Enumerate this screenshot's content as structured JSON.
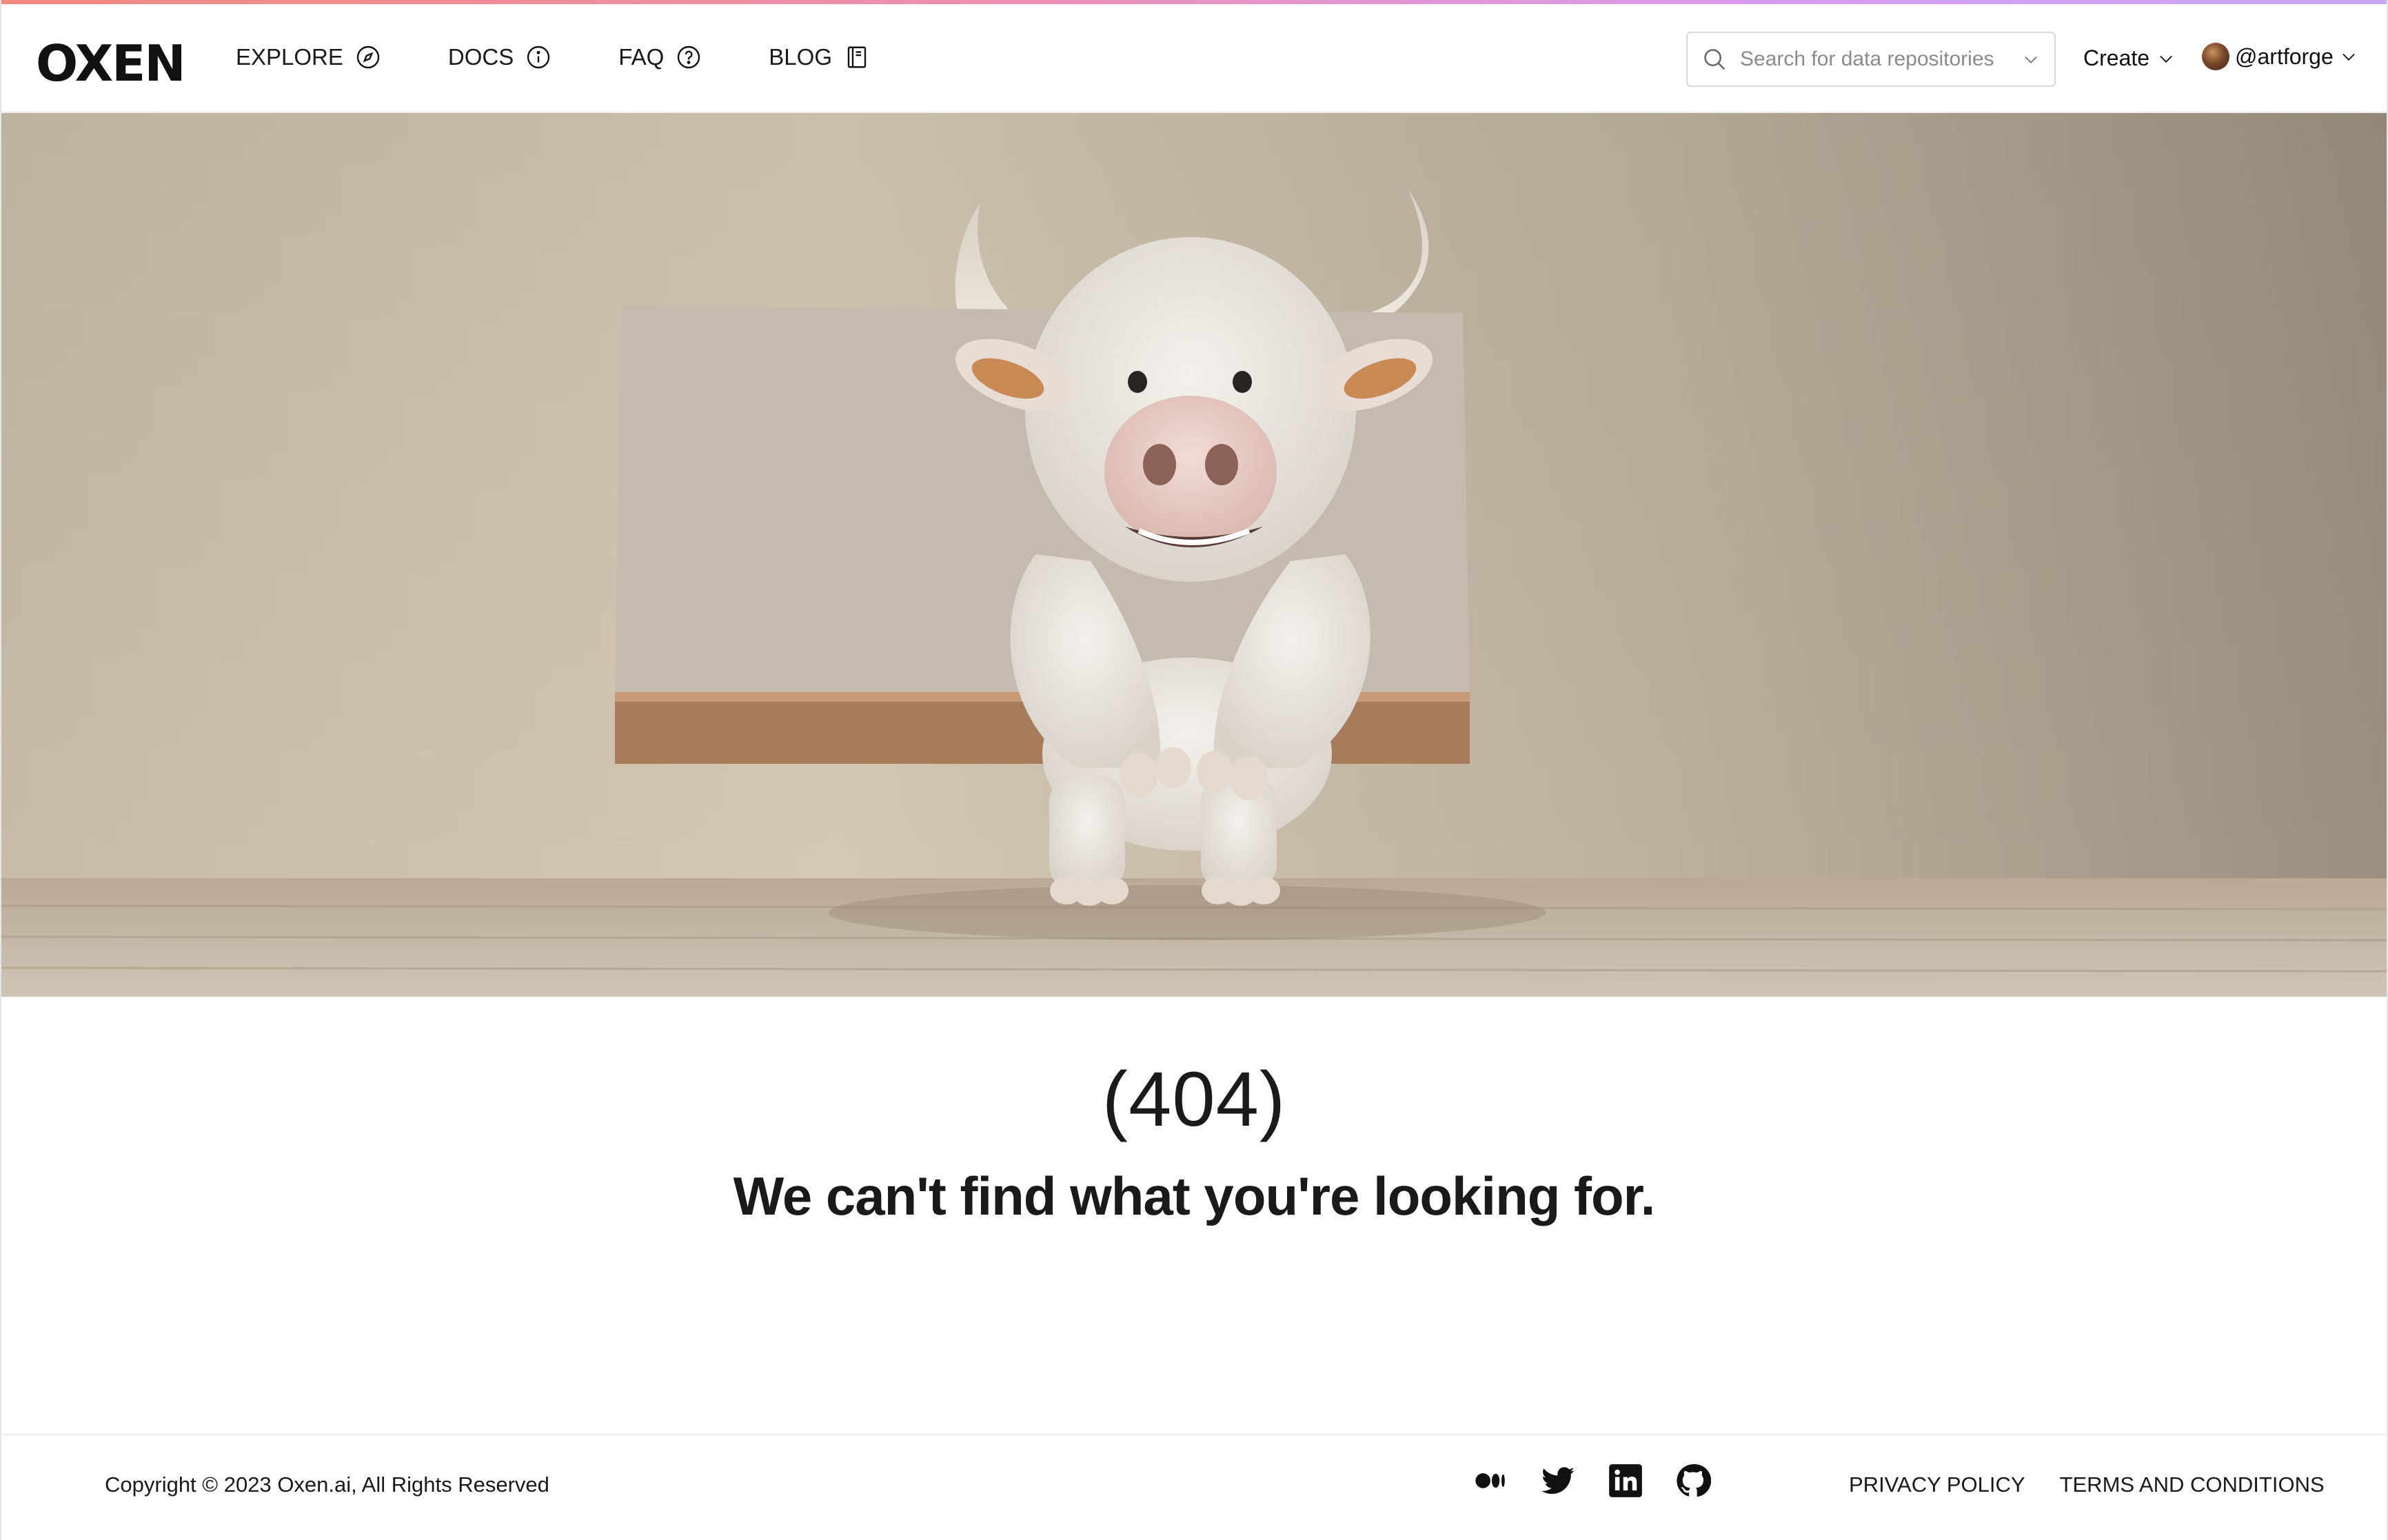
{
  "brand": {
    "logo_text": "OXEN"
  },
  "nav": {
    "items": [
      {
        "label": "EXPLORE",
        "icon": "compass-icon"
      },
      {
        "label": "DOCS",
        "icon": "info-icon"
      },
      {
        "label": "FAQ",
        "icon": "question-icon"
      },
      {
        "label": "BLOG",
        "icon": "book-icon"
      }
    ]
  },
  "search": {
    "placeholder": "Search for data repositories",
    "value": ""
  },
  "header": {
    "create_label": "Create",
    "username": "@artforge"
  },
  "hero": {
    "image": "smiling-white-ox-leaning-on-wooden-board-illustration"
  },
  "error": {
    "code": "(404)",
    "message": "We can't find what you're looking for."
  },
  "footer": {
    "copyright": "Copyright © 2023 Oxen.ai, All Rights Reserved",
    "socials": [
      "medium-icon",
      "twitter-icon",
      "linkedin-icon",
      "github-icon"
    ],
    "privacy_label": "PRIVACY POLICY",
    "terms_label": "TERMS AND CONDITIONS"
  },
  "colors": {
    "accent_gradient": [
      "#f08a7e",
      "#ef8fb0",
      "#d79cf0"
    ],
    "text": "#1a1a1a",
    "hero_bg": "#c9bdac"
  }
}
